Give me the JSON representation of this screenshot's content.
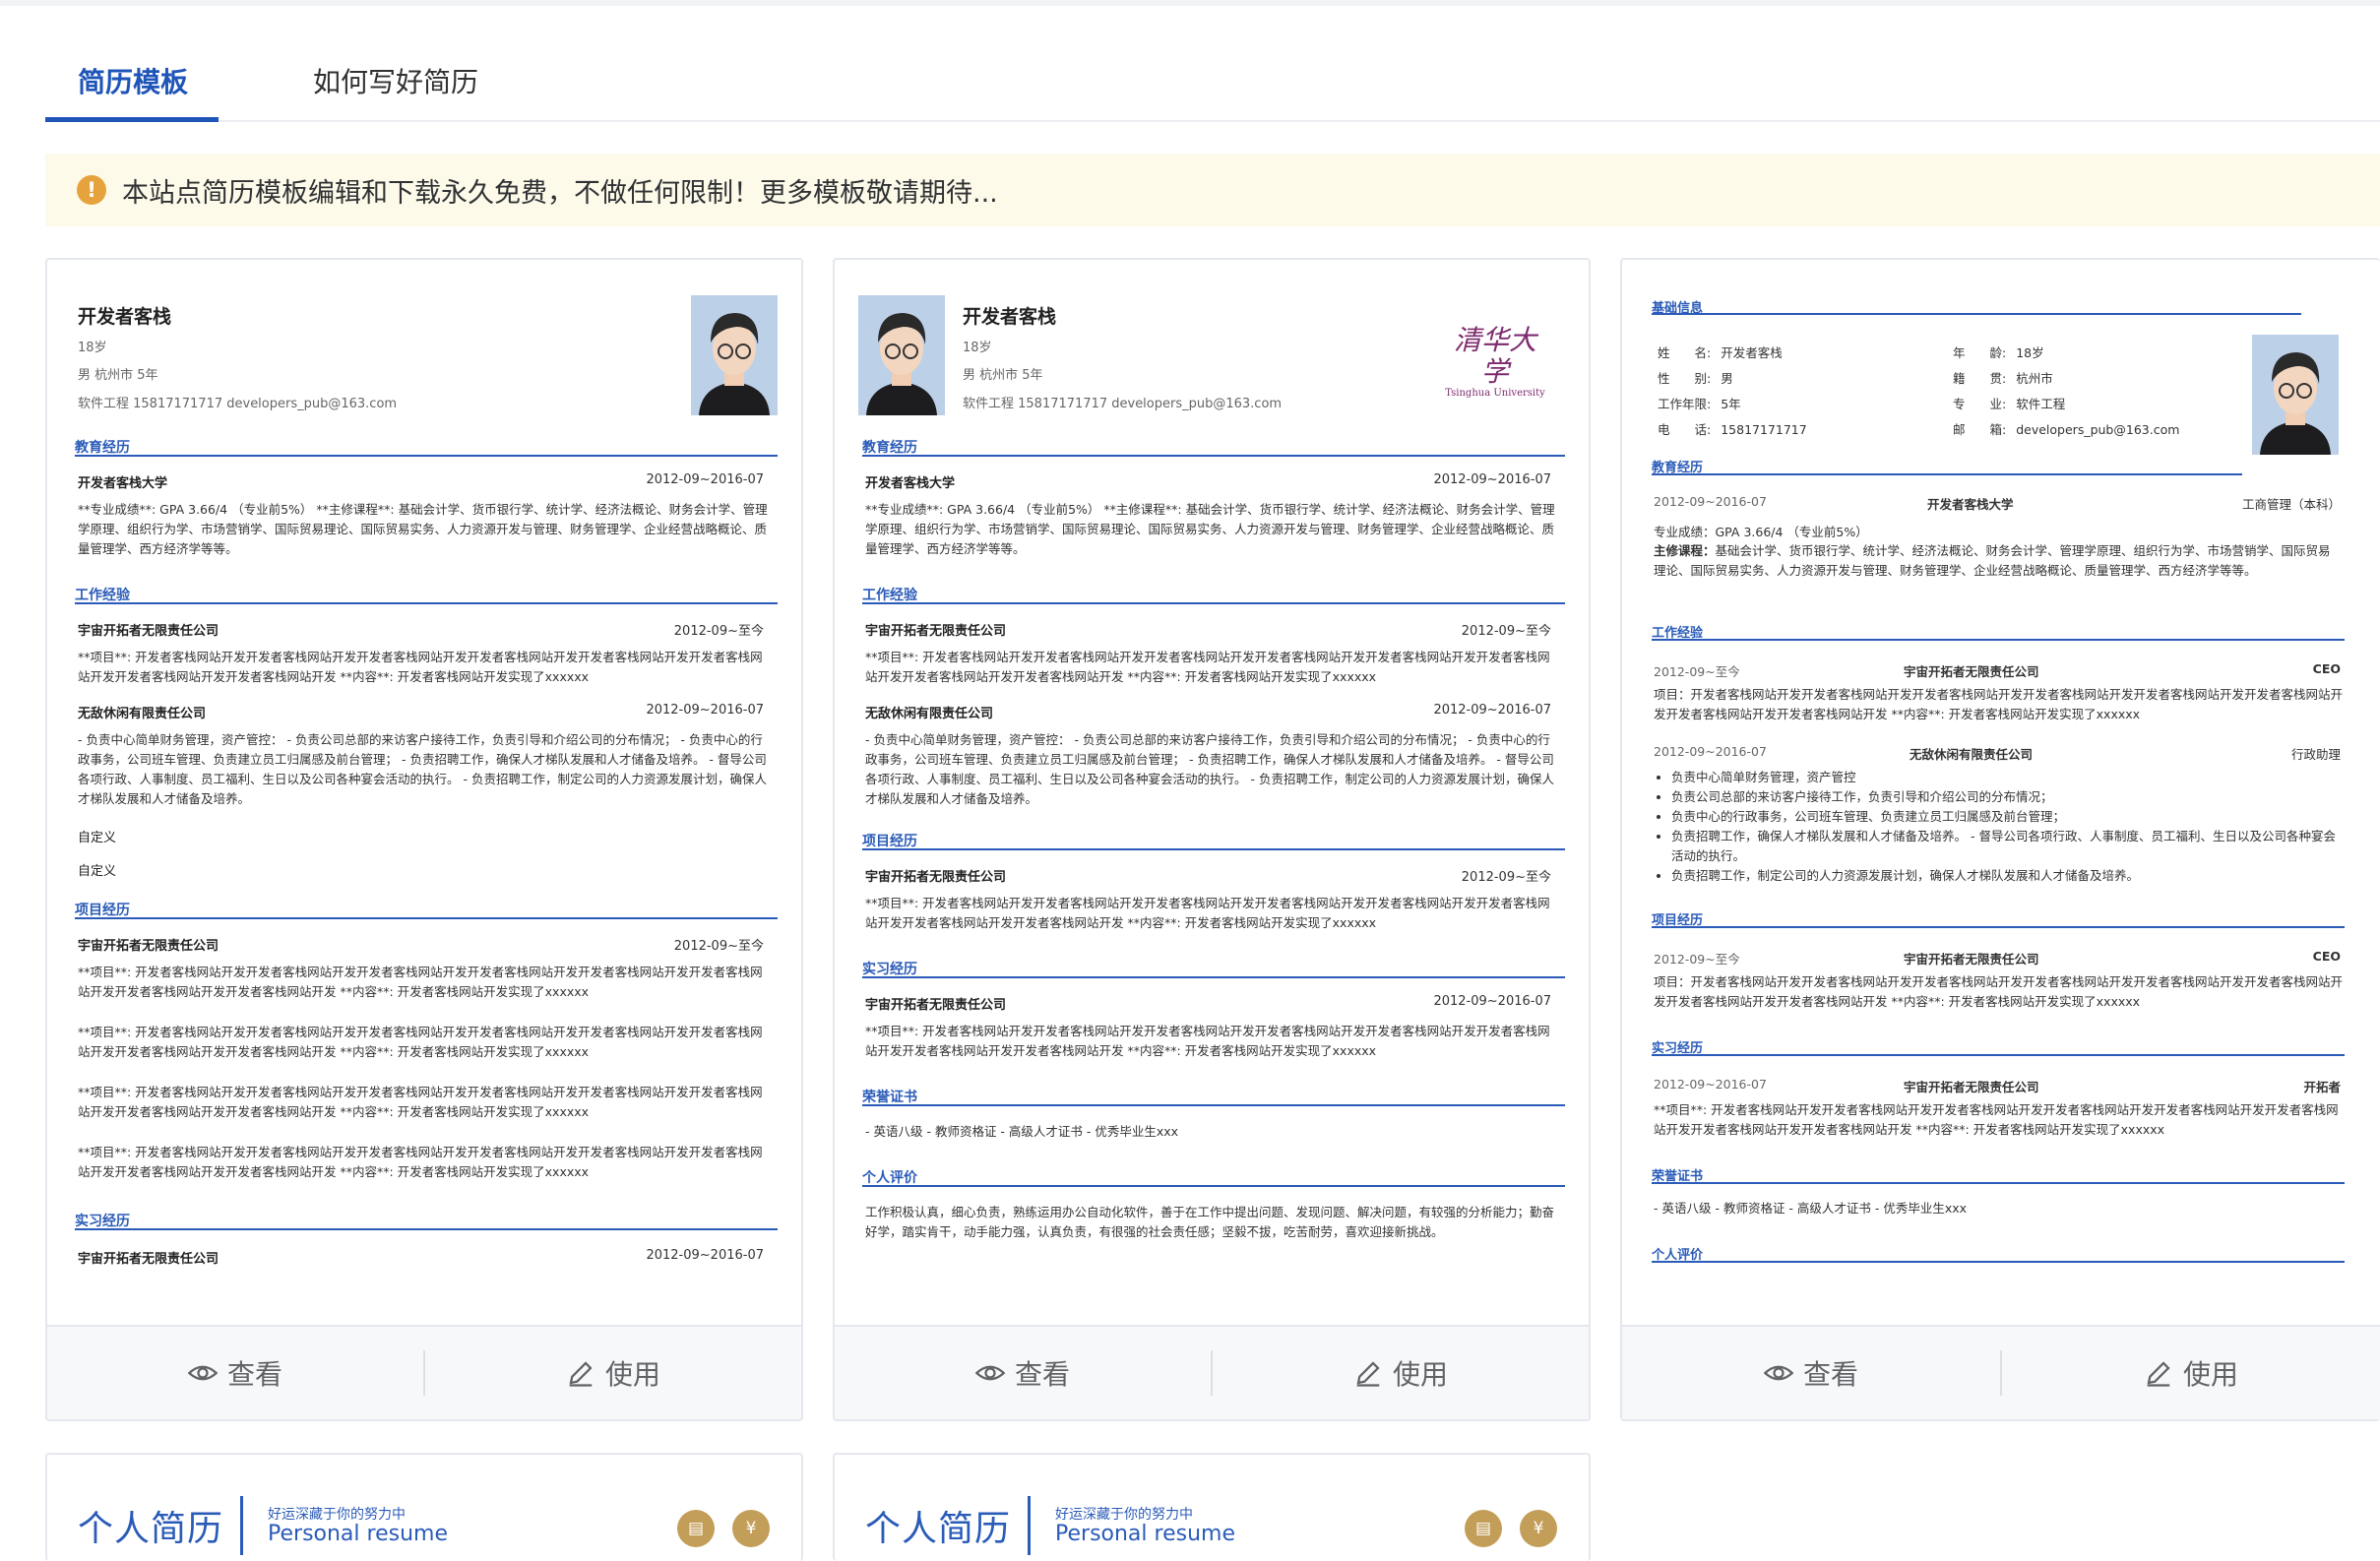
{
  "tabs": [
    {
      "label": "简历模板",
      "active": true
    },
    {
      "label": "如何写好简历",
      "active": false
    }
  ],
  "notice": {
    "icon": "warning-icon",
    "text": "本站点简历模板编辑和下载永久免费，不做任何限制！更多模板敬请期待..."
  },
  "actions": {
    "view": "查看",
    "use": "使用"
  },
  "r1": {
    "name": "开发者客栈",
    "age": "18岁",
    "line2": "男 杭州市 5年",
    "line3": "软件工程 15817171717 developers_pub@163.com",
    "edu_title": "教育经历",
    "edu_school": "开发者客栈大学",
    "edu_date": "2012-09~2016-07",
    "edu_text": "**专业成绩**: GPA 3.66/4 （专业前5%） **主修课程**: 基础会计学、货币银行学、统计学、经济法概论、财务会计学、管理学原理、组织行为学、市场营销学、国际贸易理论、国际贸易实务、人力资源开发与管理、财务管理学、企业经营战略概论、质量管理学、西方经济学等等。",
    "work_title": "工作经验",
    "w1_company": "宇宙开拓者无限责任公司",
    "w1_date": "2012-09~至今",
    "w1_text": "**项目**: 开发者客栈网站开发开发者客栈网站开发开发者客栈网站开发开发者客栈网站开发开发者客栈网站开发开发者客栈网站开发开发者客栈网站开发开发者客栈网站开发 **内容**: 开发者客栈网站开发实现了xxxxxx",
    "w2_company": "无敌休闲有限责任公司",
    "w2_date": "2012-09~2016-07",
    "w2_text": "- 负责中心简单财务管理，资产管控： - 负责公司总部的来访客户接待工作，负责引导和介绍公司的分布情况； - 负责中心的行政事务，公司班车管理、负责建立员工归属感及前台管理； - 负责招聘工作，确保人才梯队发展和人才储备及培养。 - 督导公司各项行政、人事制度、员工福利、生日以及公司各种宴会活动的执行。 - 负责招聘工作，制定公司的人力资源发展计划，确保人才梯队发展和人才储备及培养。",
    "custom1": "自定义",
    "custom2": "自定义",
    "proj_title": "项目经历",
    "p_company": "宇宙开拓者无限责任公司",
    "p_date": "2012-09~至今",
    "p_text": "**项目**: 开发者客栈网站开发开发者客栈网站开发开发者客栈网站开发开发者客栈网站开发开发者客栈网站开发开发者客栈网站开发开发者客栈网站开发开发者客栈网站开发 **内容**: 开发者客栈网站开发实现了xxxxxx",
    "intern_title": "实习经历",
    "i_company": "宇宙开拓者无限责任公司",
    "i_date": "2012-09~2016-07"
  },
  "r2": {
    "name": "开发者客栈",
    "age": "18岁",
    "line2": "男 杭州市 5年",
    "line3": "软件工程 15817171717 developers_pub@163.com",
    "logo_cn": "清华大学",
    "logo_en": "Tsinghua University",
    "edu_title": "教育经历",
    "edu_school": "开发者客栈大学",
    "edu_date": "2012-09~2016-07",
    "edu_text": "**专业成绩**: GPA 3.66/4 （专业前5%） **主修课程**: 基础会计学、货币银行学、统计学、经济法概论、财务会计学、管理学原理、组织行为学、市场营销学、国际贸易理论、国际贸易实务、人力资源开发与管理、财务管理学、企业经营战略概论、质量管理学、西方经济学等等。",
    "work_title": "工作经验",
    "w1_company": "宇宙开拓者无限责任公司",
    "w1_date": "2012-09~至今",
    "w1_text": "**项目**: 开发者客栈网站开发开发者客栈网站开发开发者客栈网站开发开发者客栈网站开发开发者客栈网站开发开发者客栈网站开发开发者客栈网站开发开发者客栈网站开发 **内容**: 开发者客栈网站开发实现了xxxxxx",
    "w2_company": "无敌休闲有限责任公司",
    "w2_date": "2012-09~2016-07",
    "w2_text": "- 负责中心简单财务管理，资产管控： - 负责公司总部的来访客户接待工作，负责引导和介绍公司的分布情况； - 负责中心的行政事务，公司班车管理、负责建立员工归属感及前台管理； - 负责招聘工作，确保人才梯队发展和人才储备及培养。 - 督导公司各项行政、人事制度、员工福利、生日以及公司各种宴会活动的执行。 - 负责招聘工作，制定公司的人力资源发展计划，确保人才梯队发展和人才储备及培养。",
    "proj_title": "项目经历",
    "p_company": "宇宙开拓者无限责任公司",
    "p_date": "2012-09~至今",
    "p_text": "**项目**: 开发者客栈网站开发开发者客栈网站开发开发者客栈网站开发开发者客栈网站开发开发者客栈网站开发开发者客栈网站开发开发者客栈网站开发开发者客栈网站开发 **内容**: 开发者客栈网站开发实现了xxxxxx",
    "intern_title": "实习经历",
    "i_company": "宇宙开拓者无限责任公司",
    "i_date": "2012-09~2016-07",
    "i_text": "**项目**: 开发者客栈网站开发开发者客栈网站开发开发者客栈网站开发开发者客栈网站开发开发者客栈网站开发开发者客栈网站开发开发者客栈网站开发开发者客栈网站开发 **内容**: 开发者客栈网站开发实现了xxxxxx",
    "honor_title": "荣誉证书",
    "honor_text": "- 英语八级 - 教师资格证 - 高级人才证书 - 优秀毕业生xxx",
    "eval_title": "个人评价",
    "eval_text": "工作积极认真，细心负责，熟练运用办公自动化软件，善于在工作中提出问题、发现问题、解决问题，有较强的分析能力；勤奋好学，踏实肯干，动手能力强，认真负责，有很强的社会责任感；坚毅不拔，吃苦耐劳，喜欢迎接新挑战。"
  },
  "r3": {
    "basic_title": "基础信息",
    "k_name": "姓　　名:",
    "v_name": "开发者客栈",
    "k_age": "年　　龄:",
    "v_age": "18岁",
    "k_sex": "性　　别:",
    "v_sex": "男",
    "k_home": "籍　　贯:",
    "v_home": "杭州市",
    "k_years": "工作年限:",
    "v_years": "5年",
    "k_major": "专　　业:",
    "v_major": "软件工程",
    "k_tel": "电　　话:",
    "v_tel": "15817171717",
    "k_mail": "邮　　箱:",
    "v_mail": "developers_pub@163.com",
    "edu_title": "教育经历",
    "edu_date": "2012-09~2016-07",
    "edu_school": "开发者客栈大学",
    "edu_major": "工商管理（本科）",
    "edu_score": "专业成绩：GPA 3.66/4 （专业前5%）",
    "edu_course_label": "主修课程：",
    "edu_course": "基础会计学、货币银行学、统计学、经济法概论、财务会计学、管理学原理、组织行为学、市场营销学、国际贸易理论、国际贸易实务、人力资源开发与管理、财务管理学、企业经营战略概论、质量管理学、西方经济学等等。",
    "work_title": "工作经验",
    "w1_date": "2012-09~至今",
    "w1_company": "宇宙开拓者无限责任公司",
    "w1_role": "CEO",
    "w1_text": "项目：开发者客栈网站开发开发者客栈网站开发开发者客栈网站开发开发者客栈网站开发开发者客栈网站开发开发者客栈网站开发开发者客栈网站开发开发者客栈网站开发 **内容**: 开发者客栈网站开发实现了xxxxxx",
    "w2_date": "2012-09~2016-07",
    "w2_company": "无敌休闲有限责任公司",
    "w2_role": "行政助理",
    "w2_bullets": [
      "负责中心简单财务管理，资产管控",
      "负责公司总部的来访客户接待工作，负责引导和介绍公司的分布情况；",
      "负责中心的行政事务，公司班车管理、负责建立员工归属感及前台管理；",
      "负责招聘工作，确保人才梯队发展和人才储备及培养。 - 督导公司各项行政、人事制度、员工福利、生日以及公司各种宴会活动的执行。",
      "负责招聘工作，制定公司的人力资源发展计划，确保人才梯队发展和人才储备及培养。"
    ],
    "proj_title": "项目经历",
    "p_date": "2012-09~至今",
    "p_company": "宇宙开拓者无限责任公司",
    "p_role": "CEO",
    "p_text": "项目：开发者客栈网站开发开发者客栈网站开发开发者客栈网站开发开发者客栈网站开发开发者客栈网站开发开发者客栈网站开发开发者客栈网站开发开发者客栈网站开发 **内容**: 开发者客栈网站开发实现了xxxxxx",
    "intern_title": "实习经历",
    "i_date": "2012-09~2016-07",
    "i_company": "宇宙开拓者无限责任公司",
    "i_role": "开拓者",
    "i_text": "**项目**: 开发者客栈网站开发开发者客栈网站开发开发者客栈网站开发开发者客栈网站开发开发者客栈网站开发开发者客栈网站开发开发者客栈网站开发开发者客栈网站开发 **内容**: 开发者客栈网站开发实现了xxxxxx",
    "honor_title": "荣誉证书",
    "honor_text": "- 英语八级 - 教师资格证 - 高级人才证书 - 优秀毕业生xxx",
    "eval_title": "个人评价"
  },
  "r4": {
    "title": "个人简历",
    "sub": "好运深藏于你的努力中",
    "en": "Personal resume"
  },
  "r5": {
    "title": "个人简历",
    "sub": "好运深藏于你的努力中",
    "en": "Personal resume"
  },
  "colors": {
    "accent": "#1f55b8",
    "section": "#2a5bb8",
    "notice_bg": "#fdfaea",
    "warning": "#e6a23c",
    "gold": "#c39e58"
  }
}
